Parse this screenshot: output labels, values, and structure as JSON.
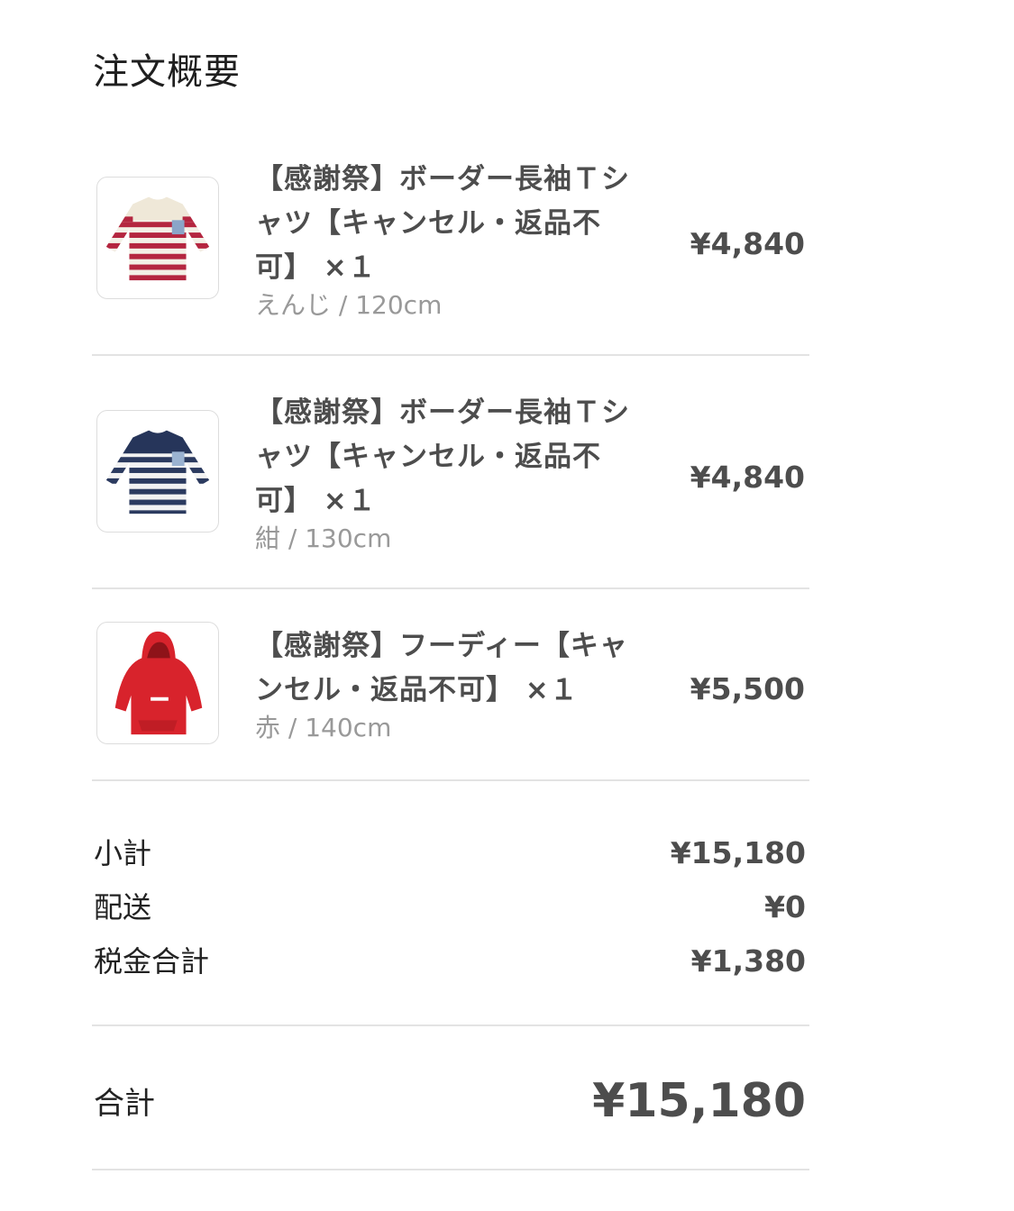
{
  "page_title": "注文概要",
  "items": [
    {
      "title": "【感謝祭】ボーダー長袖Ｔシャツ【キャンセル・返品不可】 ×１",
      "variant": "えんじ / 120cm",
      "price": "¥4,840",
      "image": "red-striped-long-sleeve-shirt"
    },
    {
      "title": "【感謝祭】ボーダー長袖Ｔシャツ【キャンセル・返品不可】 ×１",
      "variant": "紺 / 130cm",
      "price": "¥4,840",
      "image": "navy-striped-long-sleeve-shirt"
    },
    {
      "title": "【感謝祭】フーディー【キャンセル・返品不可】 ×１",
      "variant": "赤 / 140cm",
      "price": "¥5,500",
      "image": "red-hoodie"
    }
  ],
  "summary": {
    "subtotal_label": "小計",
    "subtotal_value": "¥15,180",
    "shipping_label": "配送",
    "shipping_value": "¥0",
    "tax_label": "税金合計",
    "tax_value": "¥1,380"
  },
  "total": {
    "label": "合計",
    "value": "¥15,180"
  }
}
